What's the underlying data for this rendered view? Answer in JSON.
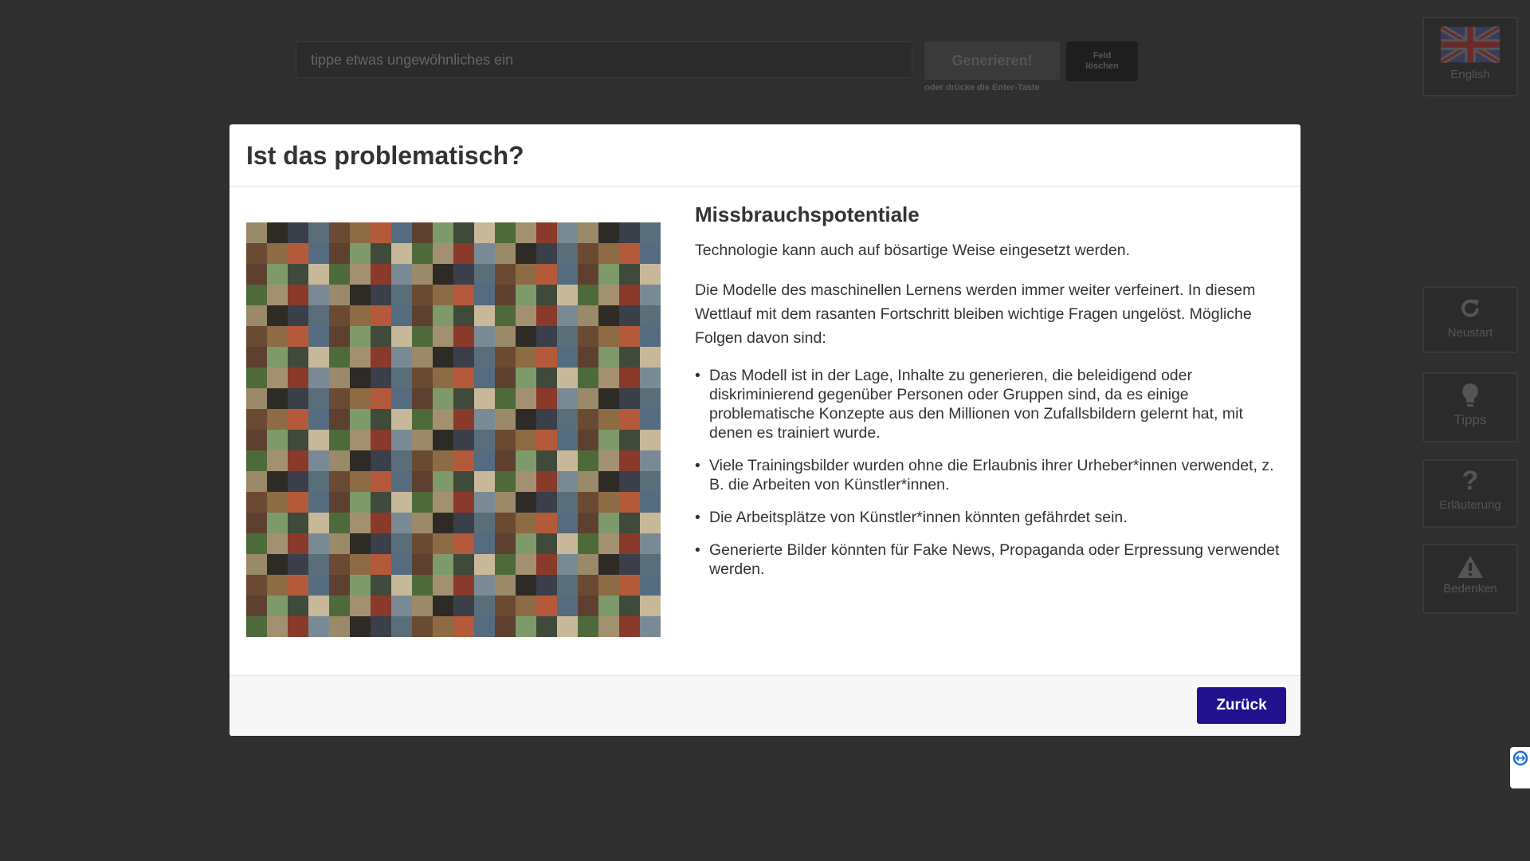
{
  "toolbar": {
    "search_placeholder": "tippe etwas ungewöhnliches ein",
    "generate_label": "Generieren!",
    "enter_hint": "oder drücke die Enter-Taste",
    "clear_label_line1": "Feld",
    "clear_label_line2": "löschen"
  },
  "sidebar": {
    "language_label": "English",
    "restart_label": "Neustart",
    "tips_label": "Tipps",
    "explanation_label": "Erläuterung",
    "concerns_label": "Bedenken"
  },
  "modal": {
    "title": "Ist das problematisch?",
    "heading": "Missbrauchspotentiale",
    "intro": "Technologie kann auch auf bösartige Weise eingesetzt werden.",
    "paragraph": "Die Modelle des maschinellen Lernens werden immer weiter verfeinert. In diesem Wettlauf mit dem rasanten Fortschritt bleiben wichtige Fragen ungelöst. Mögliche Folgen davon sind:",
    "bullets": [
      "Das Modell ist in der Lage, Inhalte zu generieren, die beleidigend oder diskriminierend gegenüber Personen oder Gruppen sind, da es einige problematische Konzepte aus den Millionen von Zufallsbildern gelernt hat, mit denen es trainiert wurde.",
      "Viele Trainingsbilder wurden ohne die Erlaubnis ihrer Urheber*innen verwendet, z. B. die Arbeiten von Künstler*innen.",
      "Die Arbeitsplätze von Künstler*innen könnten gefährdet sein.",
      "Generierte Bilder könnten für Fake News, Propaganda oder Erpressung verwendet werden."
    ],
    "back_label": "Zurück"
  },
  "colors": {
    "accent": "#21118f",
    "background": "#2f2f2f"
  },
  "icons": [
    "uk-flag-icon",
    "restart-icon",
    "lightbulb-icon",
    "question-icon",
    "warning-icon"
  ]
}
